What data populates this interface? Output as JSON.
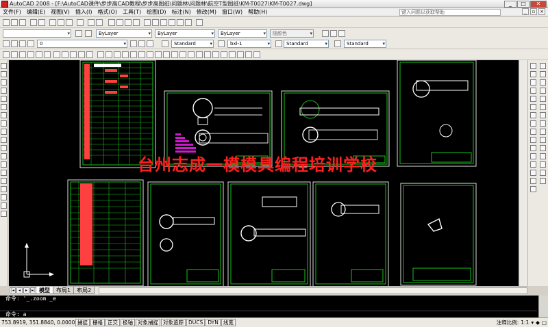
{
  "window": {
    "title": "AutoCAD 2008 - [F:\\AutoCAD课件\\步步高CAD教程\\步步高图纸\\问题林\\问题林\\航空T型图纸\\KM-T0027\\KM-T0027.dwg]"
  },
  "menu": {
    "items": [
      "文件(F)",
      "编辑(E)",
      "视图(V)",
      "插入(I)",
      "格式(O)",
      "工具(T)",
      "绘图(D)",
      "标注(N)",
      "修改(M)",
      "窗口(W)",
      "帮助(H)"
    ],
    "help_placeholder": "键入问题以获取帮助"
  },
  "properties_bar": {
    "layer": "ByLayer",
    "linetype": "ByLayer",
    "lineweight": "ByLayer",
    "plotstyle": "随颜色"
  },
  "layer_bar": {
    "layer_name": "0",
    "text_style": "Standard",
    "dim_style": "bxl-1",
    "table_style": "Standard",
    "multileader_style": "Standard"
  },
  "drawing": {
    "watermark": "台州志成一模模具编程培训学校"
  },
  "layout_tabs": [
    "模型",
    "布局1",
    "布局2"
  ],
  "command": {
    "history": "命令: '_.zoom _e",
    "prompt": "命令: a"
  },
  "status": {
    "coords": "753.8919, 351.8840, 0.0000",
    "buttons": [
      "捕捉",
      "栅格",
      "正交",
      "极轴",
      "对象捕捉",
      "对象追踪",
      "DUCS",
      "DYN",
      "线宽"
    ],
    "annotation_label": "注释比例:",
    "scale": "1:1"
  }
}
